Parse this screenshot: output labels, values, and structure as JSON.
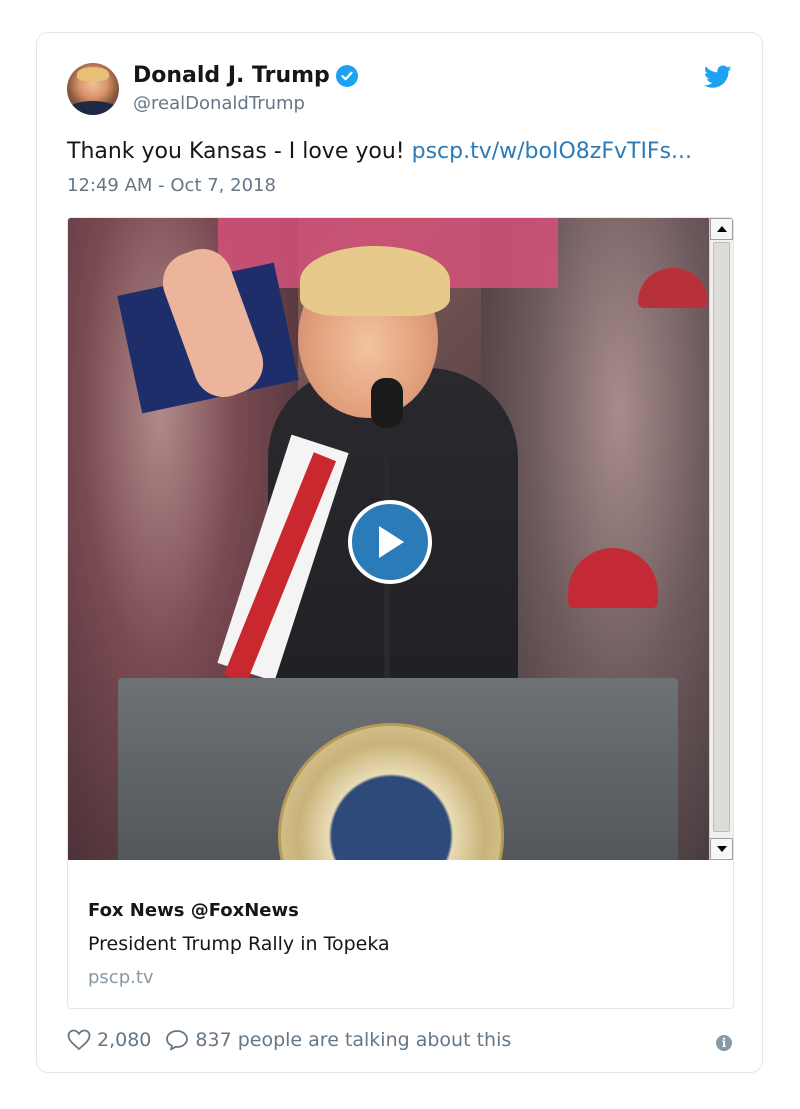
{
  "tweet": {
    "author_name": "Donald J. Trump",
    "author_handle": "@realDonaldTrump",
    "text": "Thank you Kansas - I love you!",
    "link": "pscp.tv/w/boIO8zFvTIFs...",
    "timestamp": "12:49 AM - Oct 7, 2018"
  },
  "media_card": {
    "source": "Fox News @FoxNews",
    "title": "President Trump Rally in Topeka",
    "domain": "pscp.tv"
  },
  "footer": {
    "likes": "2,080",
    "talking": "837 people are talking about this"
  },
  "icons": {
    "verified": "verified-badge-icon",
    "brand": "twitter-bird-icon",
    "play": "play-icon",
    "like": "heart-icon",
    "reply": "speech-bubble-icon",
    "info": "info-icon"
  },
  "colors": {
    "accent": "#1da1f2",
    "link": "#2b7bb9",
    "muted": "#657786",
    "border": "#e1e8ed"
  }
}
